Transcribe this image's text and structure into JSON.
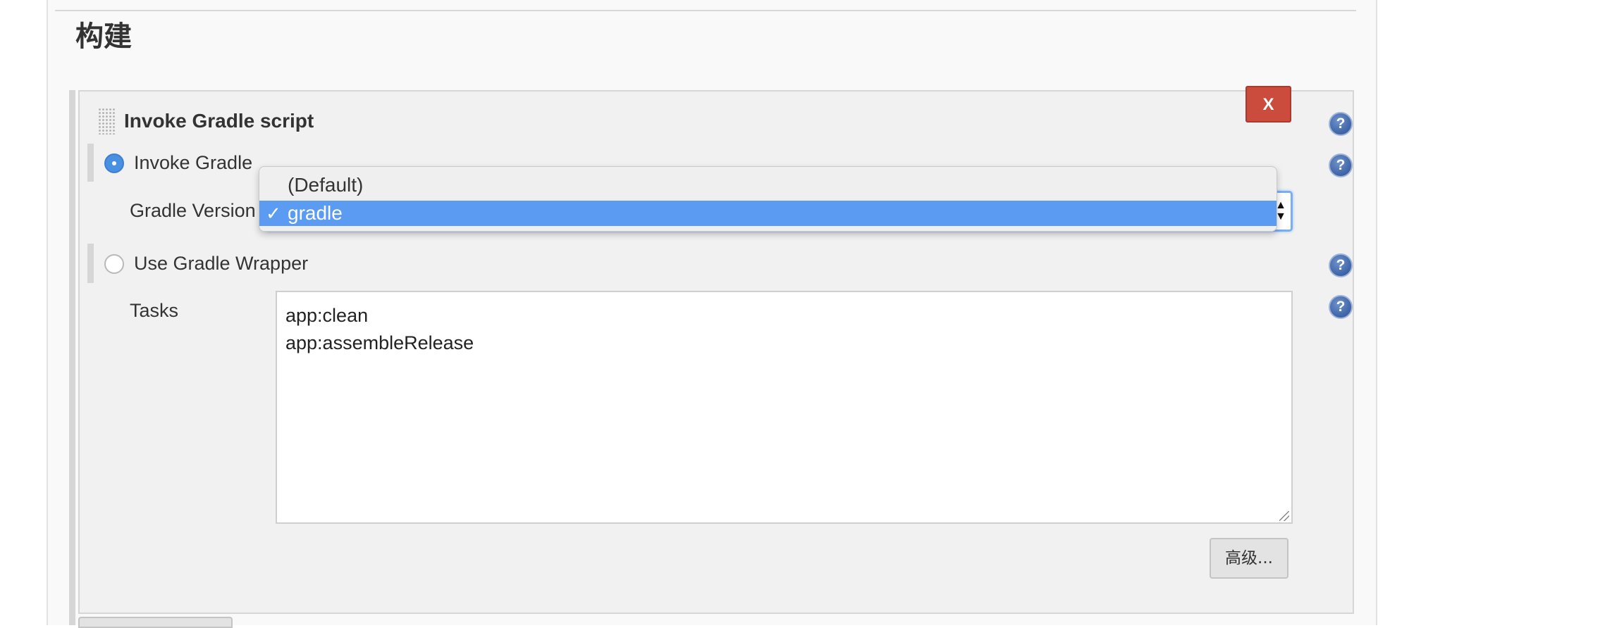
{
  "section": {
    "title": "构建"
  },
  "build_step": {
    "title": "Invoke Gradle script",
    "delete_label": "X",
    "help_glyph": "?",
    "invoke_gradle": {
      "label": "Invoke Gradle",
      "selected": true,
      "gradle_version_label": "Gradle Version",
      "gradle_version_value": "gradle",
      "dropdown_options": [
        {
          "label": "(Default)",
          "selected": false
        },
        {
          "label": "gradle",
          "selected": true
        }
      ],
      "check_glyph": "✓"
    },
    "use_wrapper": {
      "label": "Use Gradle Wrapper",
      "selected": false
    },
    "tasks": {
      "label": "Tasks",
      "value": "app:clean\napp:assembleRelease"
    },
    "advanced_label": "高级..."
  },
  "icons": {
    "help": "help-icon",
    "drag": "drag-handle-icon",
    "select_arrows": "select-arrows-icon"
  },
  "colors": {
    "delete_button": "#cb4b3c",
    "selection": "#5b9bf2",
    "radio_checked": "#4a90e2",
    "help_icon": "#3e63a6"
  }
}
